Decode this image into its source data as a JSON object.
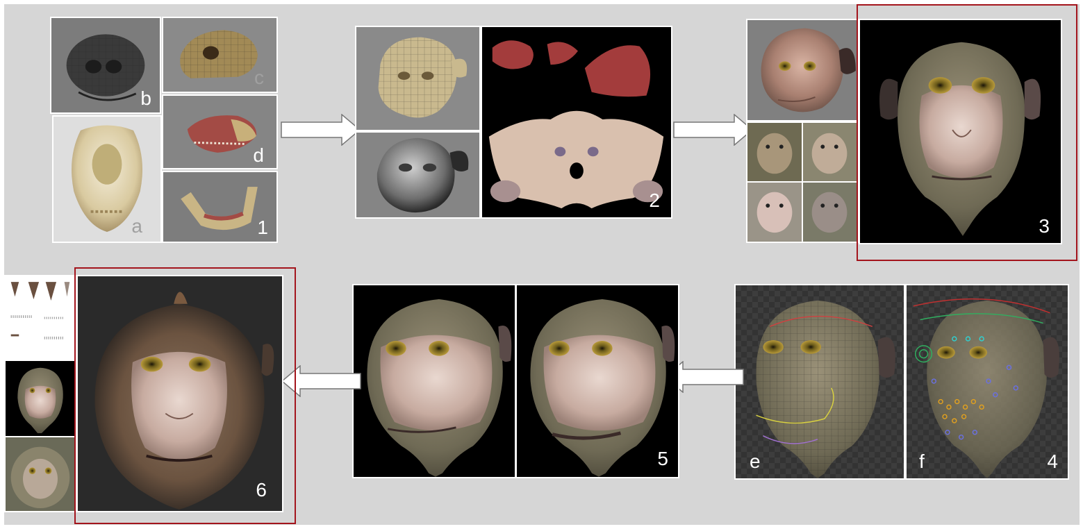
{
  "labels": {
    "a": "a",
    "b": "b",
    "c": "c",
    "d": "d",
    "e": "e",
    "f": "f",
    "step1": "1",
    "step2": "2",
    "step3": "3",
    "step4": "4",
    "step5": "5",
    "step6": "6"
  },
  "colors": {
    "background": "#d6d6d6",
    "highlight_frame": "#a3141c",
    "panel_border": "#ffffff",
    "arrow_fill": "#ffffff",
    "arrow_stroke": "#777777"
  },
  "icons": {
    "arrow": "right-arrow",
    "arrow_back": "left-arrow"
  }
}
